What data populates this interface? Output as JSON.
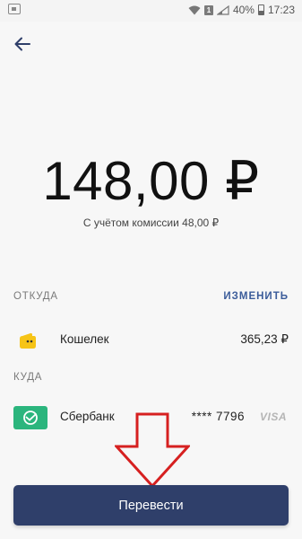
{
  "status_bar": {
    "battery": "40%",
    "time": "17:23",
    "sim_label": "1",
    "icons": [
      "wifi-icon",
      "sim-icon",
      "signal-icon",
      "battery-icon"
    ]
  },
  "header": {
    "back_icon": "arrow-left-icon"
  },
  "amount": {
    "value": "148,00 ₽",
    "commission_text": "С учётом комиссии 48,00 ₽"
  },
  "from": {
    "label": "ОТКУДА",
    "change_label": "ИЗМЕНИТЬ",
    "source_name": "Кошелек",
    "source_balance": "365,23 ₽",
    "icon": "wallet-icon"
  },
  "to": {
    "label": "КУДА",
    "bank_name": "Сбербанк",
    "card_mask": "**** 7796",
    "card_brand": "VISA",
    "icon": "sberbank-icon"
  },
  "submit": {
    "label": "Перевести"
  },
  "colors": {
    "accent": "#2f3f6a",
    "link": "#3b5c9a",
    "wallet_yellow": "#f6c417",
    "sber_green": "#2bb57d",
    "annotation_red": "#d62020"
  }
}
